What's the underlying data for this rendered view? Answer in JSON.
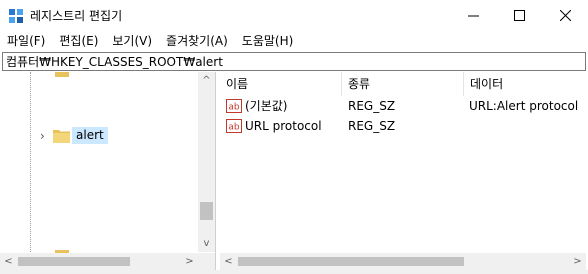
{
  "window": {
    "title": "레지스트리 편집기"
  },
  "menubar": {
    "items": [
      {
        "label": "파일(F)"
      },
      {
        "label": "편집(E)"
      },
      {
        "label": "보기(V)"
      },
      {
        "label": "즐겨찾기(A)"
      },
      {
        "label": "도움말(H)"
      }
    ]
  },
  "address": {
    "path": "컴퓨터₩HKEY_CLASSES_ROOT₩alert"
  },
  "tree": {
    "selected_node": "alert"
  },
  "list": {
    "columns": [
      "이름",
      "종류",
      "데이터"
    ],
    "rows": [
      {
        "name": "(기본값)",
        "type": "REG_SZ",
        "data": "URL:Alert protocol"
      },
      {
        "name": "URL protocol",
        "type": "REG_SZ",
        "data": ""
      }
    ]
  },
  "icons": {
    "value": "string-value-icon",
    "folder": "folder-icon"
  },
  "colors": {
    "selection": "#cce8ff",
    "folder": "#e8c25a",
    "value_icon": "#c0392b"
  }
}
